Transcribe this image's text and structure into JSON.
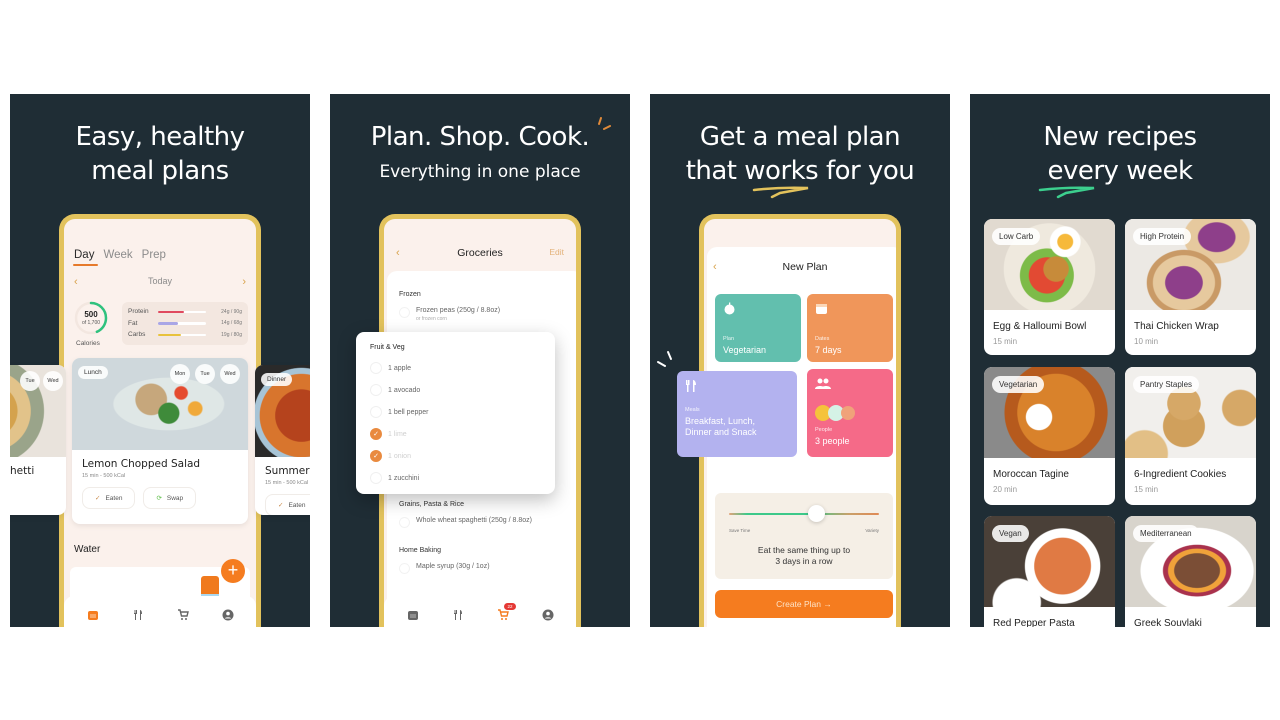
{
  "panels": [
    {
      "headline": [
        "Easy, healthy",
        "meal plans"
      ],
      "screen": {
        "tabs": [
          "Day",
          "Week",
          "Prep"
        ],
        "active_tab": "Day",
        "date_label": "Today",
        "calories": {
          "value": "500",
          "of": "of 1,700",
          "label": "Calories",
          "progress": 0.29
        },
        "macros": [
          {
            "name": "Protein",
            "value": "24g / 90g",
            "progress": 0.27,
            "color": "#e04a5f"
          },
          {
            "name": "Fat",
            "value": "14g / 68g",
            "progress": 0.21,
            "color": "#a9a6e6"
          },
          {
            "name": "Carbs",
            "value": "19g / 80g",
            "progress": 0.24,
            "color": "#e8c23c"
          }
        ],
        "meal_cards": [
          {
            "title": "hetti",
            "days": [
              "Tue",
              "Wed"
            ]
          },
          {
            "label": "Lunch",
            "title": "Lemon Chopped Salad",
            "meta": "15 min - 500 kCal",
            "days": [
              "Mon",
              "Tue",
              "Wed"
            ],
            "eaten_label": "Eaten",
            "swap_label": "Swap"
          },
          {
            "label": "Dinner",
            "title": "Summer",
            "meta": "15 min - 500 kCal",
            "eaten_label": "Eaten"
          }
        ],
        "water_label": "Water",
        "add_label": "+"
      }
    },
    {
      "headline": [
        "Plan. Shop. Cook."
      ],
      "subheadline": "Everything in one place",
      "screen": {
        "back": "‹",
        "title": "Groceries",
        "edit_label": "Edit",
        "sections": [
          {
            "name": "Frozen",
            "items": [
              {
                "label": "Frozen peas (250g / 8.8oz)",
                "sub": "or frozen corn"
              }
            ]
          },
          {
            "name": "Grains, Pasta & Rice",
            "items": [
              {
                "label": "Whole wheat spaghetti (250g / 8.8oz)"
              }
            ]
          },
          {
            "name": "Home Baking",
            "items": [
              {
                "label": "Maple syrup (30g / 1oz)"
              }
            ]
          }
        ],
        "popup": {
          "name": "Fruit & Veg",
          "items": [
            {
              "label": "1 apple",
              "checked": false
            },
            {
              "label": "1 avocado",
              "checked": false
            },
            {
              "label": "1 bell pepper",
              "checked": false
            },
            {
              "label": "1 lime",
              "checked": true
            },
            {
              "label": "1 onion",
              "checked": true
            },
            {
              "label": "1 zucchini",
              "checked": false
            }
          ]
        },
        "cart_badge": "22"
      }
    },
    {
      "headline": [
        "Get a meal plan",
        "that works for you"
      ],
      "screen": {
        "back": "‹",
        "title": "New Plan",
        "tiles": [
          {
            "label": "Plan",
            "value": "Vegetarian",
            "color": "#62bfae"
          },
          {
            "label": "Dates",
            "value": "7 days",
            "color": "#f0965a"
          },
          {
            "label": "Meals",
            "value": "Breakfast, Lunch, Dinner and Snack",
            "color": "#b3b2ef"
          },
          {
            "label": "People",
            "value": "3 people",
            "color": "#f56a88"
          }
        ],
        "slider": {
          "left_label": "Save Time",
          "right_label": "Variety",
          "value": 0.58,
          "description": "Eat the same thing up to 3 days in a row"
        },
        "cta": "Create Plan →"
      }
    },
    {
      "headline": [
        "New recipes",
        "every week"
      ],
      "recipes": [
        {
          "tag": "Low Carb",
          "title": "Egg & Halloumi Bowl",
          "time": "15 min"
        },
        {
          "tag": "High Protein",
          "title": "Thai Chicken Wrap",
          "time": "10 min"
        },
        {
          "tag": "Vegetarian",
          "title": "Moroccan Tagine",
          "time": "20 min"
        },
        {
          "tag": "Pantry Staples",
          "title": "6-Ingredient Cookies",
          "time": "15 min"
        },
        {
          "tag": "Vegan",
          "title": "Red Pepper Pasta",
          "time": ""
        },
        {
          "tag": "Mediterranean",
          "title": "Greek Souvlaki",
          "time": ""
        }
      ]
    }
  ],
  "colors": {
    "panel_bg": "#1f2d35",
    "phone_frame": "#e2c25c",
    "accent": "#f57c1f"
  }
}
